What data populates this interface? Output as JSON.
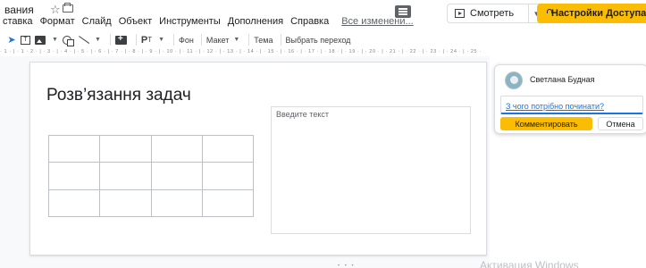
{
  "header": {
    "doc_title": "вания",
    "menu": [
      "ставка",
      "Формат",
      "Слайд",
      "Объект",
      "Инструменты",
      "Дополнения",
      "Справка"
    ],
    "last_edit": "Все изменени...",
    "present_label": "Смотреть",
    "share_label": "Настройки Доступа"
  },
  "toolbar": {
    "background_label": "Фон",
    "layout_label": "Макет",
    "theme_label": "Тема",
    "transition_label": "Выбрать переход"
  },
  "ruler": "· 1 · | · 1 · 2 · | · 3 · | · 4 · | · 5 · | · 6 · | · 7 · | · 8 · | · 9 · | · 10 · | · 11 · | · 12 · | · 13 · | · 14 · | · 15 · | · 16 · | · 17 · | · 18 · | · 19 · | · 20 · | · 21 · | · 22 · | · 23 · | · 24 · | · 25 ·",
  "slide": {
    "title": "Розв’язання задач",
    "table": {
      "rows": 3,
      "cols": 4
    },
    "textbox_placeholder": "Введите текст"
  },
  "comment": {
    "author": "Светлана Будная",
    "draft_text": "З чого потрібно починати?",
    "submit_label": "Комментировать",
    "cancel_label": "Отмена"
  },
  "overlay": {
    "watermark": "Активация Windows",
    "page_dots": "• • •"
  },
  "colors": {
    "accent": "#fbbc04",
    "link": "#1a73e8",
    "border": "#dadce0"
  }
}
